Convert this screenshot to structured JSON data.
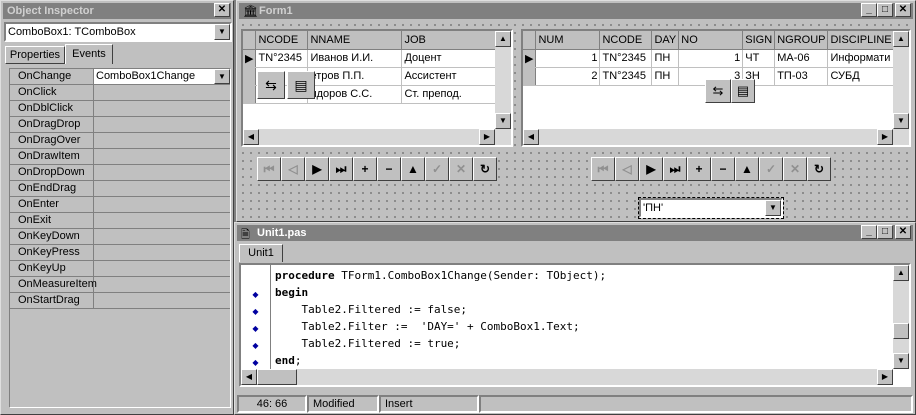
{
  "inspector": {
    "title": "Object Inspector",
    "selector": "ComboBox1: TComboBox",
    "tabs": [
      "Properties",
      "Events"
    ],
    "events": [
      {
        "name": "OnChange",
        "value": "ComboBox1Change"
      },
      {
        "name": "OnClick",
        "value": ""
      },
      {
        "name": "OnDblClick",
        "value": ""
      },
      {
        "name": "OnDragDrop",
        "value": ""
      },
      {
        "name": "OnDragOver",
        "value": ""
      },
      {
        "name": "OnDrawItem",
        "value": ""
      },
      {
        "name": "OnDropDown",
        "value": ""
      },
      {
        "name": "OnEndDrag",
        "value": ""
      },
      {
        "name": "OnEnter",
        "value": ""
      },
      {
        "name": "OnExit",
        "value": ""
      },
      {
        "name": "OnKeyDown",
        "value": ""
      },
      {
        "name": "OnKeyPress",
        "value": ""
      },
      {
        "name": "OnKeyUp",
        "value": ""
      },
      {
        "name": "OnMeasureItem",
        "value": ""
      },
      {
        "name": "OnStartDrag",
        "value": ""
      }
    ]
  },
  "form": {
    "title": "Form1",
    "grid1": {
      "headers": [
        "NCODE",
        "NNAME",
        "JOB"
      ],
      "rows": [
        [
          "TN°2345",
          "Иванов И.И.",
          "Доцент"
        ],
        [
          "",
          "етров П.П.",
          "Ассистент"
        ],
        [
          "",
          "идоров С.С.",
          "Ст. препод."
        ]
      ]
    },
    "grid2": {
      "headers": [
        "NUM",
        "NCODE",
        "DAY",
        "NO",
        "SIGN",
        "NGROUP",
        "DISCIPLINE"
      ],
      "rows": [
        [
          "1",
          "TN°2345",
          "ПН",
          "1",
          "ЧТ",
          "МА-06",
          "Информати"
        ],
        [
          "2",
          "TN°2345",
          "ПН",
          "3",
          "ЗН",
          "ТП-03",
          "СУБД"
        ]
      ]
    },
    "combo_value": "'ПН'"
  },
  "editor": {
    "title": "Unit1.pas",
    "tab": "Unit1",
    "lines": [
      {
        "kw": "procedure",
        "rest": " TForm1.ComboBox1Change(Sender: TObject);"
      },
      {
        "kw": "begin",
        "rest": ""
      },
      {
        "kw": "",
        "rest": "    Table2.Filtered := false;"
      },
      {
        "kw": "",
        "rest": "    Table2.Filter :=  'DAY=' + ComboBox1.Text;"
      },
      {
        "kw": "",
        "rest": "    Table2.Filtered := true;"
      },
      {
        "kw": "end",
        "rest": ";"
      }
    ],
    "status": {
      "position": "46:  66",
      "modified": "Modified",
      "mode": "Insert"
    }
  }
}
